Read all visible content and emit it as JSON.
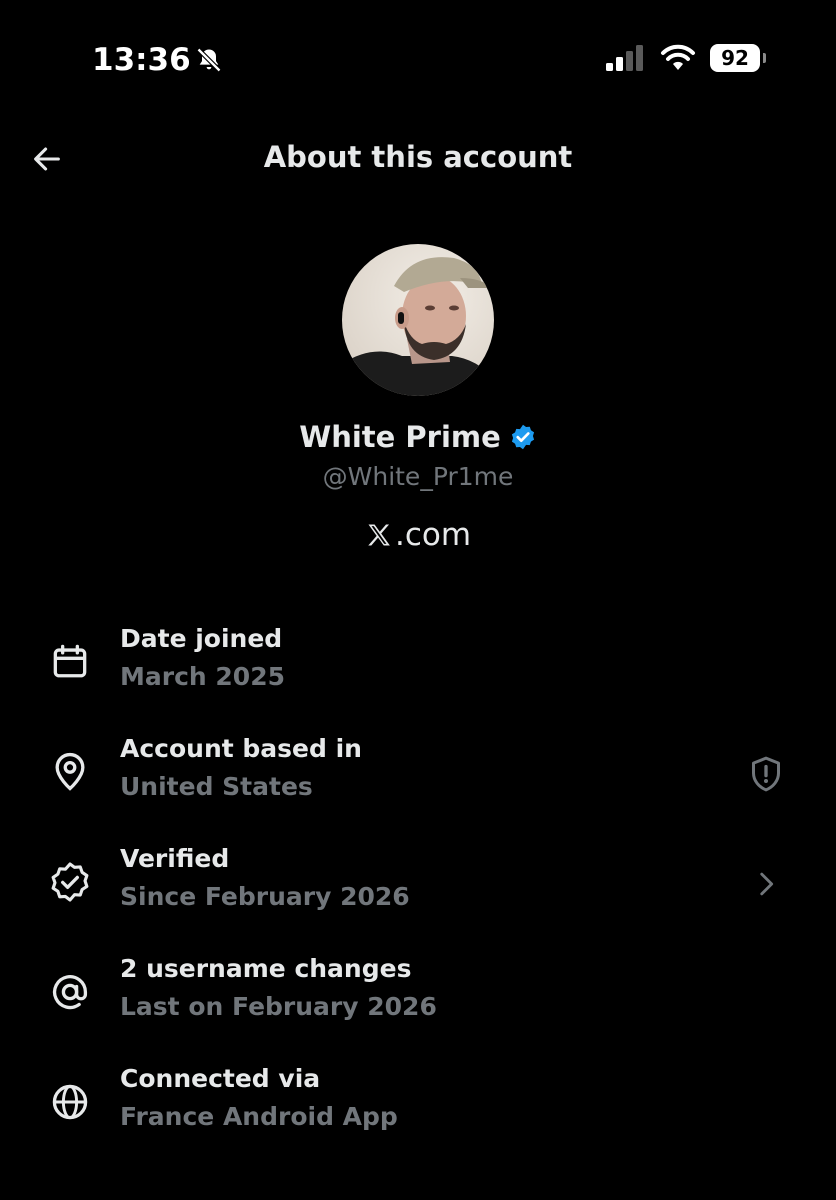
{
  "status_bar": {
    "time": "13:36",
    "battery": "92"
  },
  "header": {
    "title": "About this account"
  },
  "profile": {
    "display_name": "White Prime",
    "handle": "@White_Pr1me",
    "site_suffix": ".com",
    "verified_color": "#1d9bf0"
  },
  "info": [
    {
      "label": "Date joined",
      "value": "March 2025",
      "icon": "calendar-icon"
    },
    {
      "label": "Account based in",
      "value": "United States",
      "icon": "location-pin-icon",
      "action": "shield-alert-icon"
    },
    {
      "label": "Verified",
      "value": "Since February 2026",
      "icon": "verified-badge-icon",
      "action": "chevron-right-icon"
    },
    {
      "label": "2 username changes",
      "value": "Last on February 2026",
      "icon": "at-sign-icon"
    },
    {
      "label": "Connected via",
      "value": "France Android App",
      "icon": "globe-icon"
    }
  ]
}
